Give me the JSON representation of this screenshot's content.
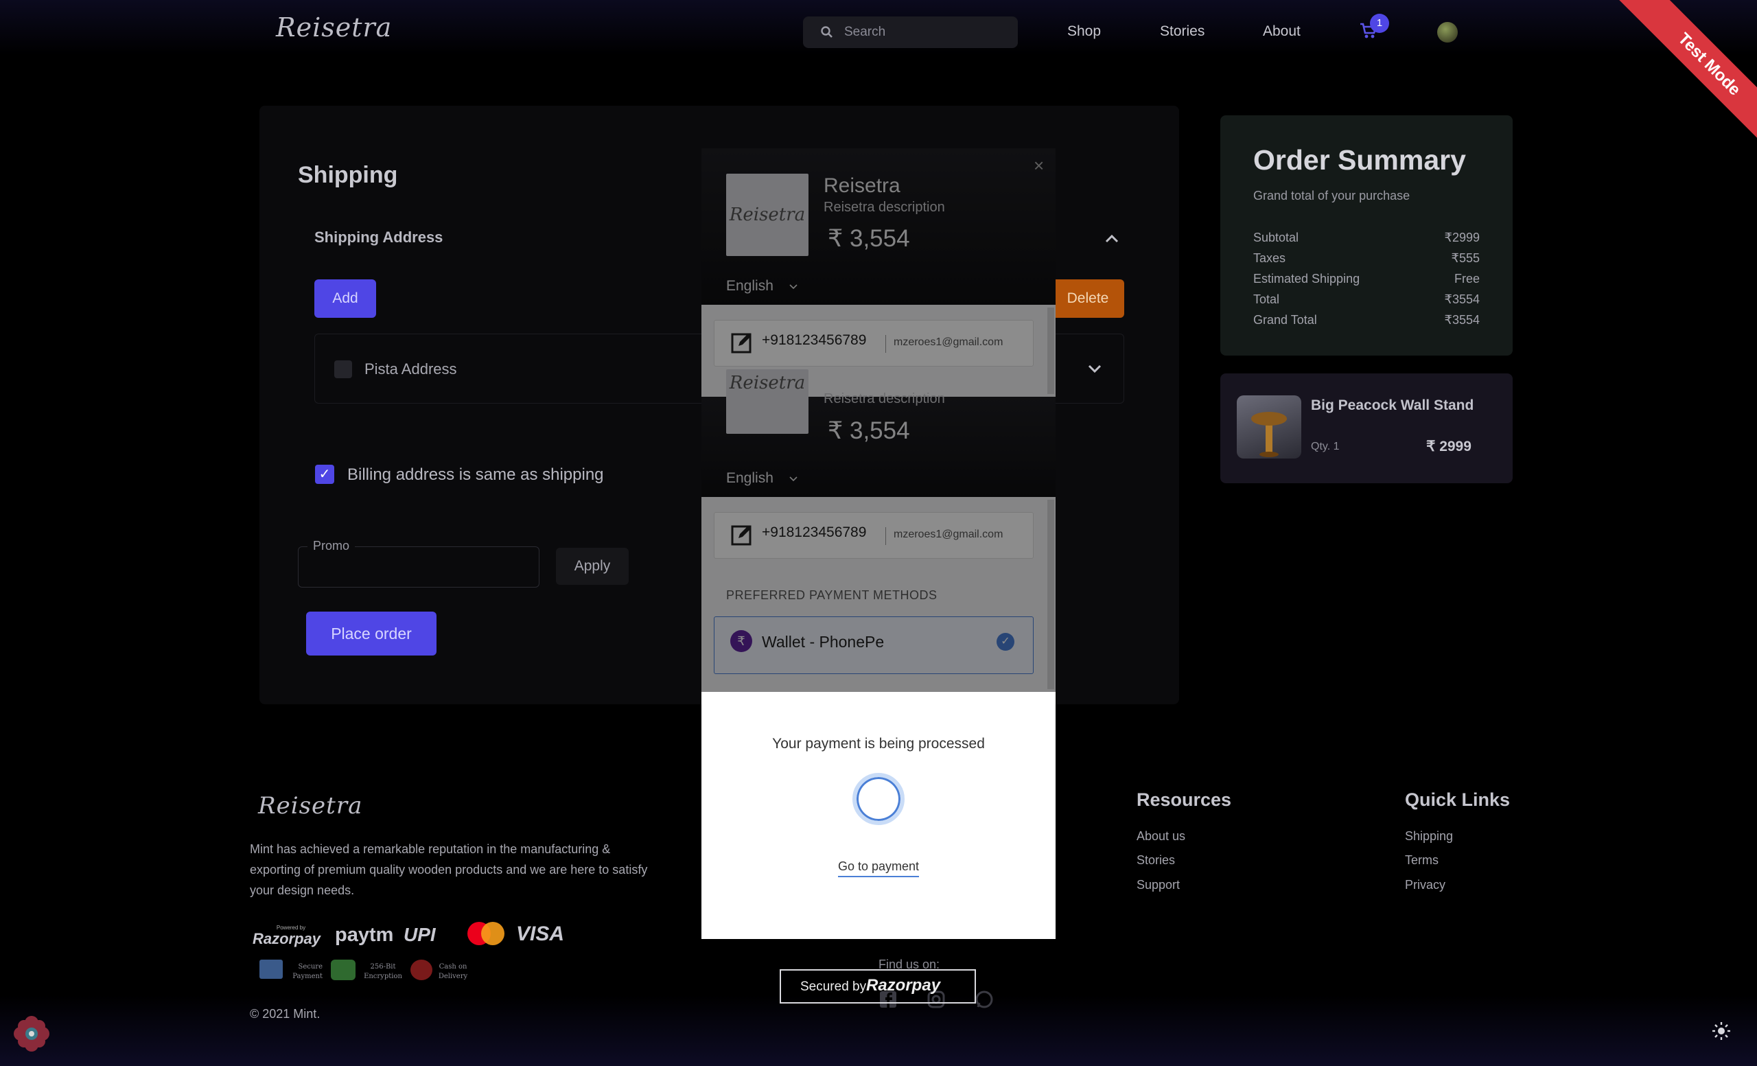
{
  "header": {
    "logo": "Reisetra",
    "search_placeholder": "Search",
    "nav": [
      "Shop",
      "Stories",
      "About"
    ],
    "cart_count": "1",
    "test_mode": "Test Mode"
  },
  "shipping": {
    "title": "Shipping",
    "address_section": "Shipping Address",
    "add_label": "Add",
    "delete_label": "Delete",
    "address_name": "Pista Address",
    "billing_same_label": "Billing address is same as shipping",
    "billing_same_checked": true,
    "promo_label": "Promo",
    "promo_value": "",
    "apply_label": "Apply",
    "place_order_label": "Place order"
  },
  "summary": {
    "title": "Order Summary",
    "subtitle": "Grand total of your purchase",
    "rows": [
      {
        "label": "Subtotal",
        "value": "₹2999"
      },
      {
        "label": "Taxes",
        "value": "₹555"
      },
      {
        "label": "Estimated Shipping",
        "value": "Free"
      },
      {
        "label": "Total",
        "value": "₹3554"
      },
      {
        "label": "Grand Total",
        "value": "₹3554"
      }
    ],
    "item": {
      "name": "Big Peacock Wall Stand",
      "qty": "Qty. 1",
      "price": "₹ 2999"
    }
  },
  "footer": {
    "logo": "Reisetra",
    "about_text": "Mint has achieved a remarkable reputation in the manufacturing & exporting of premium quality wooden products and we are here to satisfy your design needs.",
    "payment_logos": [
      "Razorpay",
      "paytm",
      "UPI",
      "VISA"
    ],
    "powered_by": "Powered by",
    "badges": [
      "Secure Payment",
      "256-Bit Encryption",
      "Cash on Delivery"
    ],
    "copyright": "© 2021 Mint.",
    "resources_title": "Resources",
    "resources": [
      "About us",
      "Stories",
      "Support"
    ],
    "quick_title": "Quick Links",
    "quick": [
      "Shipping",
      "Terms",
      "Privacy"
    ],
    "find_us": "Find us on:"
  },
  "checkout": {
    "merchant": "Reisetra",
    "description": "Reisetra description",
    "amount": "₹ 3,554",
    "language": "English",
    "phone": "+918123456789",
    "email": "mzeroes1@gmail.com",
    "preferred_label": "PREFERRED PAYMENT METHODS",
    "wallet": "Wallet - PhonePe",
    "processing_text": "Your payment is being processed",
    "go_to_payment": "Go to payment",
    "secured_by": "Secured by",
    "secured_brand": "Razorpay"
  },
  "colors": {
    "accent": "#4f46e5",
    "delete": "#b45309",
    "modal_selected": "#4a7fd6",
    "ribbon": "#d9363e"
  }
}
